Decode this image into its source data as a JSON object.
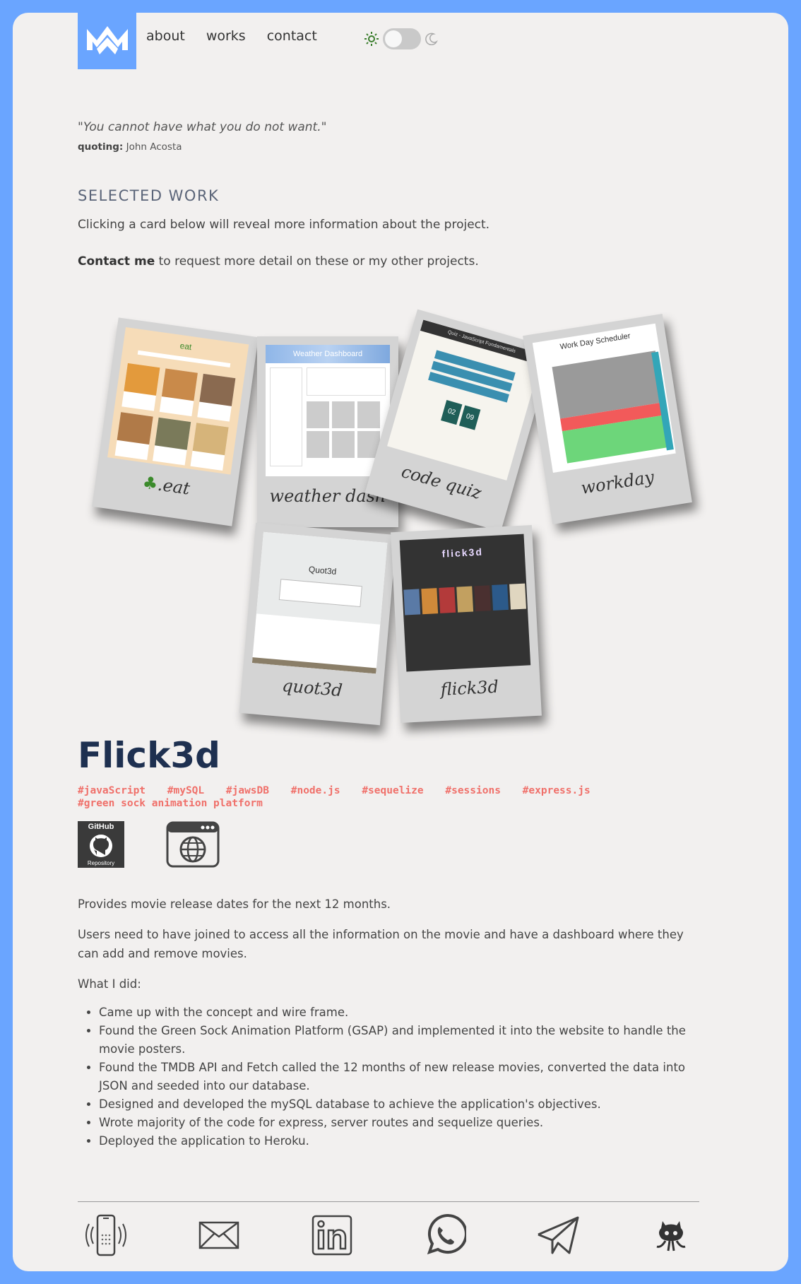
{
  "nav": {
    "items": [
      "about",
      "works",
      "contact"
    ]
  },
  "quote": {
    "text": "\"You cannot have what you do not want.\"",
    "label": "quoting:",
    "author": " John Acosta"
  },
  "selected_work": {
    "title": "SELECTED WORK",
    "intro": "Clicking a card below will reveal more information about the project.",
    "contact_bold": "Contact me",
    "contact_rest": " to request more detail on these or my other projects."
  },
  "cards": [
    {
      "caption": ".eat",
      "screen_title": "eat"
    },
    {
      "caption": "weather dash",
      "screen_title": "Weather Dashboard"
    },
    {
      "caption": "code quiz",
      "screen_title": "Quiz - JavaScript Fundamentals"
    },
    {
      "caption": "workday",
      "screen_title": "Work Day Scheduler"
    },
    {
      "caption": "quot3d",
      "screen_title": "Quot3d"
    },
    {
      "caption": "flick3d",
      "screen_title": "flick3d"
    }
  ],
  "project": {
    "title": "Flick3d",
    "tags": [
      "#javaScript",
      "#mySQL",
      "#jawsDB",
      "#node.js",
      "#sequelize",
      "#sessions",
      "#express.js",
      "#green sock animation platform"
    ],
    "github_label_top": "GitHub",
    "github_label_bottom": "Repository",
    "p1": "Provides movie release dates for the next 12 months.",
    "p2": "Users need to have joined to access all the information on the movie and have a dashboard where they can add and remove movies.",
    "p3": "What I did:",
    "bullets": [
      "Came up with the concept and wire frame.",
      "Found the Green Sock Animation Platform (GSAP) and implemented it into the website to handle the movie posters.",
      "Found the TMDB API and Fetch called the 12 months of new release movies, converted the data into JSON and seeded into our database.",
      "Designed and developed the mySQL database to achieve the application's objectives.",
      "Wrote majority of the code for express, server routes and sequelize queries.",
      "Deployed the application to Heroku."
    ]
  },
  "colors": {
    "frame": "#6aa5ff",
    "background": "#f2f0ef",
    "title": "#1e3050",
    "tags": "#f0706a"
  },
  "footer_icons": [
    "phone-icon",
    "mail-icon",
    "linkedin-icon",
    "whatsapp-icon",
    "telegram-icon",
    "github-octocat-icon"
  ]
}
